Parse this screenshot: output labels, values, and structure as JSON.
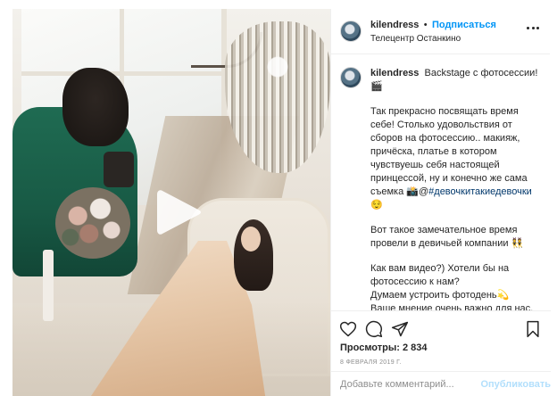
{
  "post": {
    "username": "kilendress",
    "separator": "•",
    "follow_label": "Подписаться",
    "location": "Телецентр Останкино"
  },
  "caption": {
    "first_line": "Backstage с фотосессии! 🎬",
    "body_part1": "Так прекрасно посвящать время себе! Столько удовольствия от сборов на фотосессию.. макияж, причёска, платье в котором чувствуешь себя настоящей принцессой, ну и конечно же сама съемка 📸@",
    "hashtag": "#девочкитакиедевочки",
    "body_part1_end": " 😌",
    "paragraph2": "Вот такое замечательное время провели в девичьей компании 👯",
    "paragraph3": "Как вам видео?) Хотели бы на фотосессию к нам?\nДумаем устроить фотодень💫\nВаше мнение очень важно для нас, пишите в комментариях⬆️💙"
  },
  "stats": {
    "views_label": "Просмотры: 2 834",
    "date": "8 февраля 2019 г."
  },
  "comment": {
    "placeholder": "Добавьте комментарий...",
    "publish_label": "Опубликовать"
  },
  "icons": {
    "like": "heart-icon",
    "comment": "comment-icon",
    "share": "share-icon",
    "save": "bookmark-icon",
    "play": "play-icon",
    "more": "more-icon"
  },
  "colors": {
    "follow": "#0095f6",
    "publish_disabled": "#b2dffc",
    "date": "#8e8e8e"
  }
}
